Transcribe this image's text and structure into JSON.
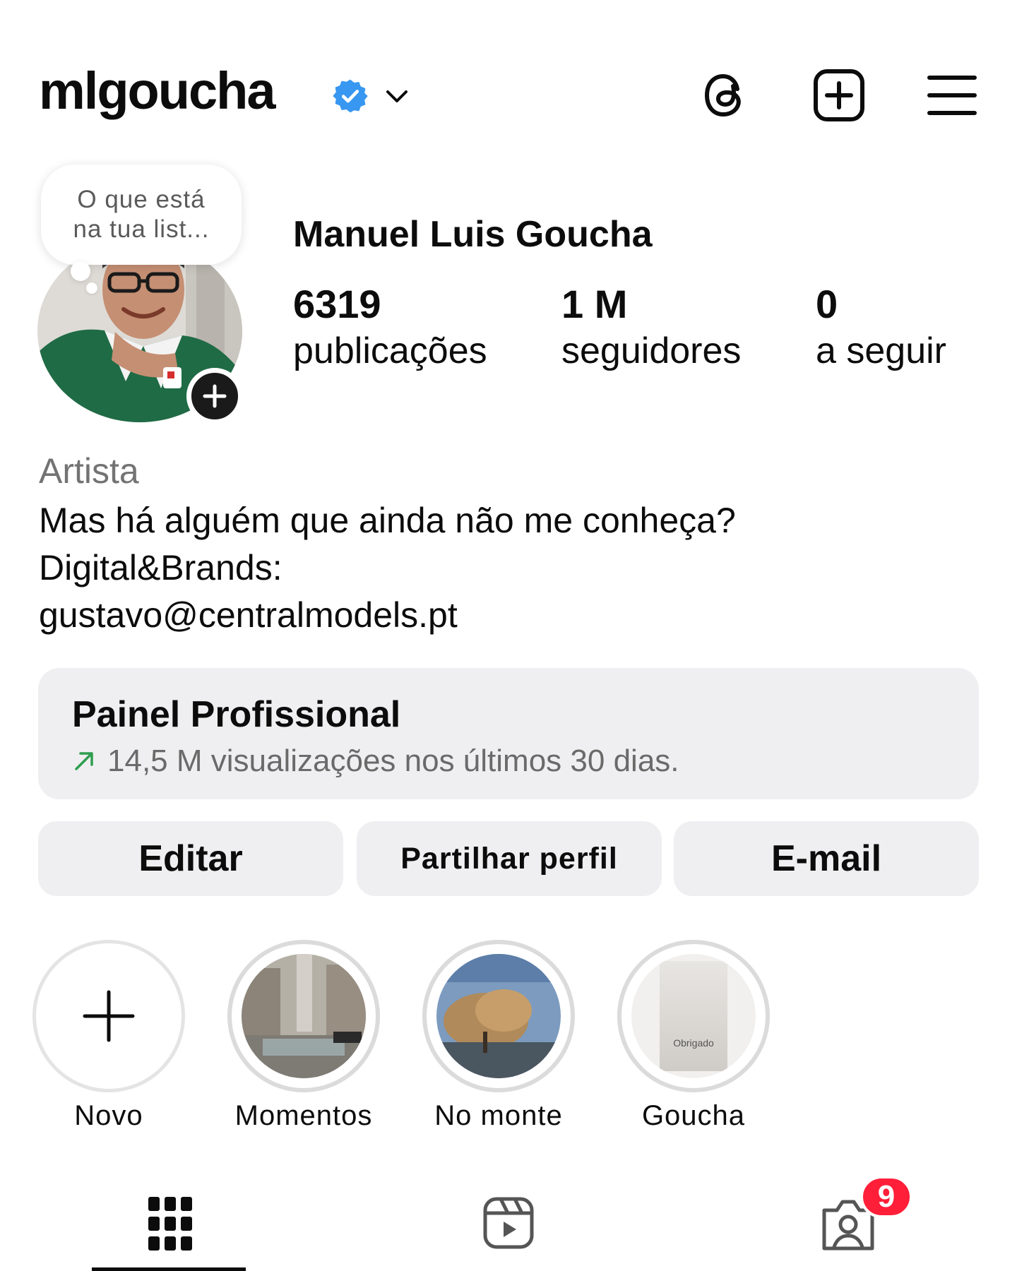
{
  "header": {
    "username": "mlgoucha",
    "verified": true,
    "icons": [
      "threads-icon",
      "create-post-icon",
      "menu-icon"
    ]
  },
  "note": {
    "line1": "O que está",
    "line2": "na tua list..."
  },
  "profile": {
    "full_name": "Manuel Luis Goucha",
    "stats": [
      {
        "value": "6319",
        "label": "publicações"
      },
      {
        "value": "1 M",
        "label": "seguidores"
      },
      {
        "value": "0",
        "label": "a seguir"
      }
    ]
  },
  "bio": {
    "category": "Artista",
    "lines": [
      "Mas há alguém que ainda não me conheça?",
      "Digital&Brands:",
      "gustavo@centralmodels.pt"
    ]
  },
  "dashboard": {
    "title": "Painel Profissional",
    "subtitle": "14,5 M visualizações nos últimos 30 dias."
  },
  "buttons": {
    "edit": "Editar",
    "share": "Partilhar perfil",
    "email": "E-mail"
  },
  "highlights": [
    {
      "label": "Novo"
    },
    {
      "label": "Momentos"
    },
    {
      "label": "No monte"
    },
    {
      "label": "Goucha",
      "thumb_text": "Obrigado"
    }
  ],
  "tabs": {
    "items": [
      "grid-icon",
      "reels-icon",
      "tagged-icon"
    ],
    "tagged_badge": "9"
  },
  "colors": {
    "verified_blue": "#3897f0",
    "button_bg": "#efeff1",
    "badge_red": "#ff1f39",
    "trend_green": "#2e9e4f"
  }
}
